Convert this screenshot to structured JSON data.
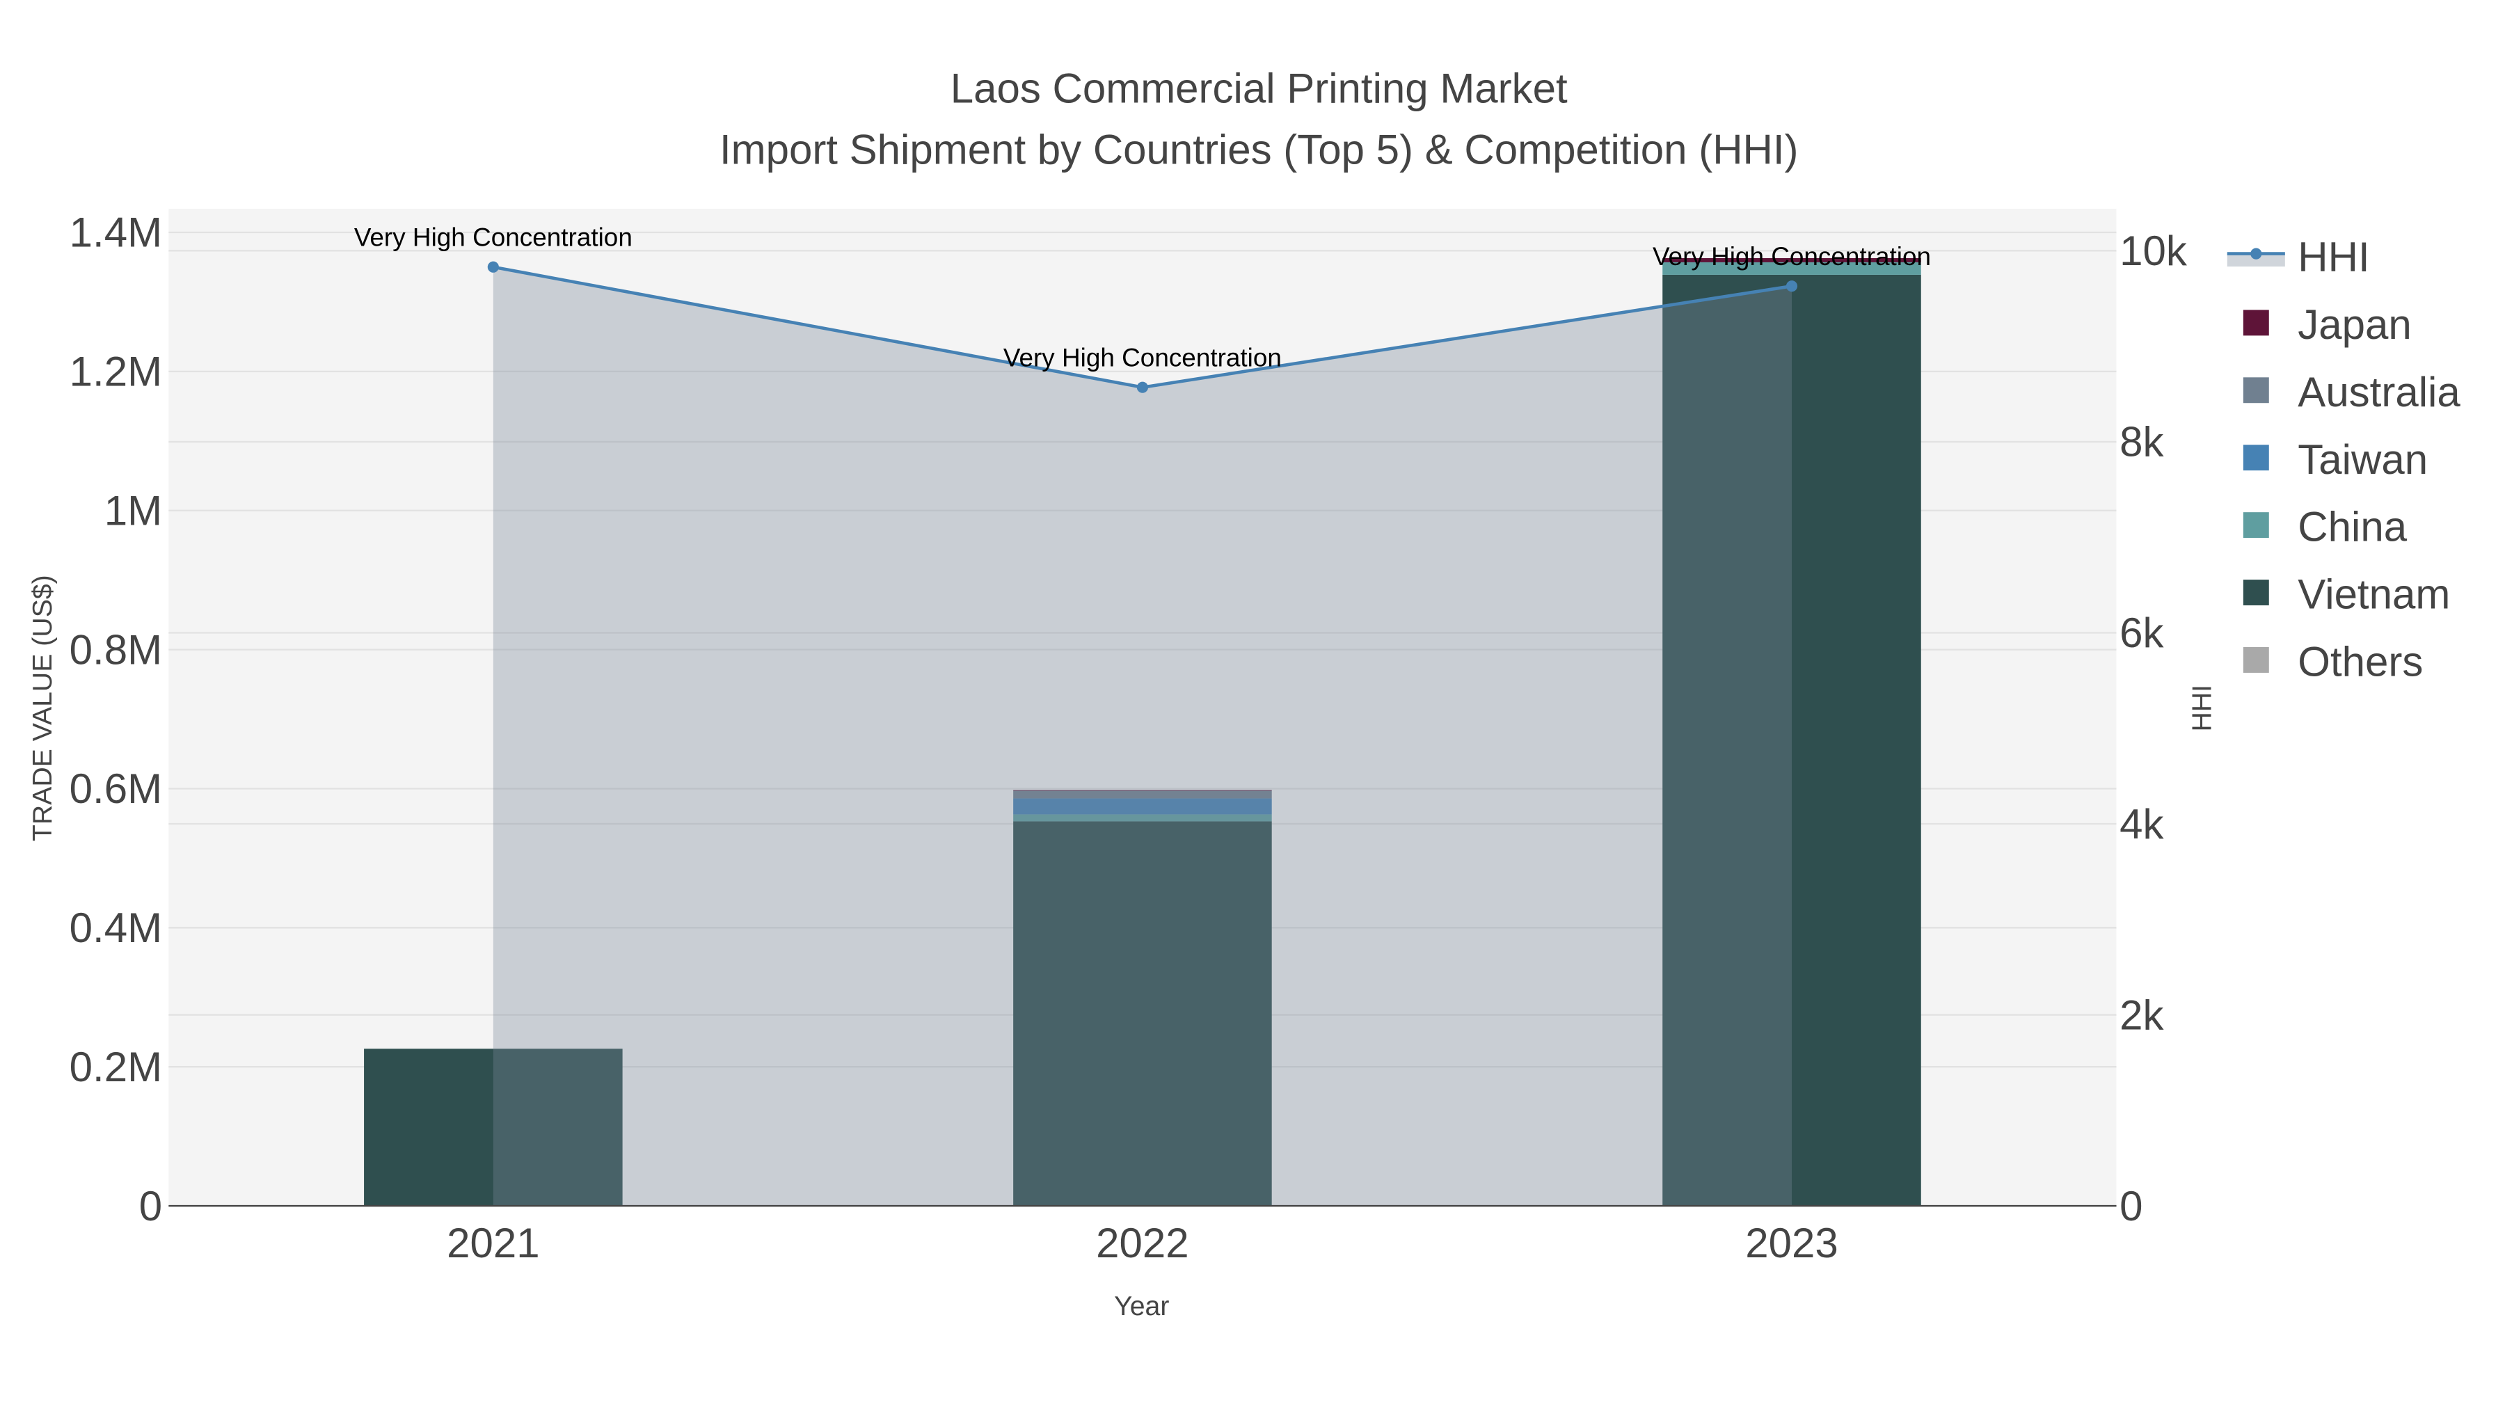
{
  "chart_data": {
    "type": "bar",
    "title": "Laos Commercial Printing Market",
    "subtitle": "Import Shipment by Countries (Top 5) & Competition (HHI)",
    "xlabel": "Year",
    "ylabel": "TRADE VALUE (US$)",
    "y2label": "HHI",
    "categories": [
      "2021",
      "2022",
      "2023"
    ],
    "barmode": "stack",
    "series": [
      {
        "name": "Vietnam",
        "color": "#2f4f4f",
        "values": [
          226000,
          553000,
          1339000
        ]
      },
      {
        "name": "China",
        "color": "#5f9ea0",
        "values": [
          0,
          10000,
          18000
        ]
      },
      {
        "name": "Taiwan",
        "color": "#4682b4",
        "values": [
          0,
          23000,
          0
        ]
      },
      {
        "name": "Australia",
        "color": "#708090",
        "values": [
          0,
          11000,
          0
        ]
      },
      {
        "name": "Japan",
        "color": "#5e1438",
        "values": [
          0,
          1000,
          6000
        ]
      },
      {
        "name": "Others",
        "color": "#a9a9a9",
        "values": [
          0,
          0,
          0
        ]
      }
    ],
    "hhi": {
      "name": "HHI",
      "color": "#4682b4",
      "values": [
        9830,
        8570,
        9630
      ],
      "annotations": [
        "Very High Concentration",
        "Very High Concentration",
        "Very High Concentration"
      ]
    },
    "ylim": [
      0,
      1434000
    ],
    "y2lim": [
      0,
      10440
    ],
    "yticks": [
      {
        "v": 0,
        "label": "0"
      },
      {
        "v": 200000,
        "label": "0.2M"
      },
      {
        "v": 400000,
        "label": "0.4M"
      },
      {
        "v": 600000,
        "label": "0.6M"
      },
      {
        "v": 800000,
        "label": "0.8M"
      },
      {
        "v": 1000000,
        "label": "1M"
      },
      {
        "v": 1200000,
        "label": "1.2M"
      },
      {
        "v": 1400000,
        "label": "1.4M"
      }
    ],
    "y2ticks": [
      {
        "v": 0,
        "label": "0"
      },
      {
        "v": 2000,
        "label": "2k"
      },
      {
        "v": 4000,
        "label": "4k"
      },
      {
        "v": 6000,
        "label": "6k"
      },
      {
        "v": 8000,
        "label": "8k"
      },
      {
        "v": 10000,
        "label": "10k"
      }
    ],
    "legend_order": [
      "HHI",
      "Japan",
      "Australia",
      "Taiwan",
      "China",
      "Vietnam",
      "Others"
    ],
    "legend_position": "right",
    "grid": true
  }
}
